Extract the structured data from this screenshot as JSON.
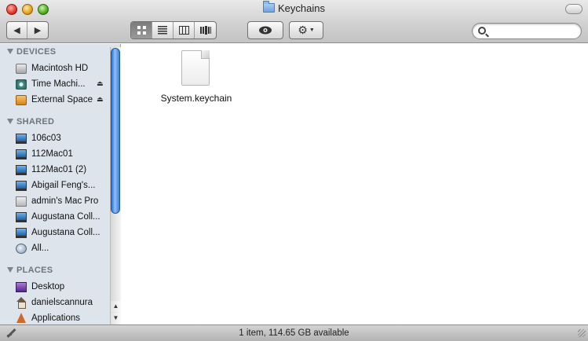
{
  "window": {
    "title": "Keychains"
  },
  "toolbar": {
    "back_icon": "triangle-left-icon",
    "forward_icon": "triangle-right-icon",
    "views": [
      "icon-view",
      "list-view",
      "column-view",
      "coverflow-view"
    ],
    "active_view": "icon-view",
    "quicklook_icon": "eye-icon",
    "action_icon": "gear-icon",
    "search": {
      "value": "",
      "placeholder": ""
    }
  },
  "sidebar": {
    "sections": [
      {
        "title": "DEVICES",
        "items": [
          {
            "label": "Macintosh HD",
            "icon": "hard-drive-icon",
            "eject": false
          },
          {
            "label": "Time Machi...",
            "icon": "time-machine-icon",
            "eject": true
          },
          {
            "label": "External Space",
            "icon": "external-drive-icon",
            "eject": true
          }
        ]
      },
      {
        "title": "SHARED",
        "items": [
          {
            "label": "106c03",
            "icon": "computer-icon"
          },
          {
            "label": "112Mac01",
            "icon": "computer-icon"
          },
          {
            "label": "112Mac01 (2)",
            "icon": "computer-icon"
          },
          {
            "label": "Abigail Feng's...",
            "icon": "computer-icon"
          },
          {
            "label": "admin's Mac Pro",
            "icon": "mac-pro-icon"
          },
          {
            "label": "Augustana Coll...",
            "icon": "computer-icon"
          },
          {
            "label": "Augustana Coll...",
            "icon": "computer-icon"
          },
          {
            "label": "All...",
            "icon": "network-icon"
          }
        ]
      },
      {
        "title": "PLACES",
        "items": [
          {
            "label": "Desktop",
            "icon": "desktop-icon"
          },
          {
            "label": "danielscannura",
            "icon": "home-icon"
          },
          {
            "label": "Applications",
            "icon": "applications-icon"
          }
        ]
      }
    ]
  },
  "content": {
    "files": [
      {
        "name": "System.keychain",
        "icon": "document-icon"
      }
    ]
  },
  "status": {
    "text": "1 item, 114.65 GB available"
  }
}
